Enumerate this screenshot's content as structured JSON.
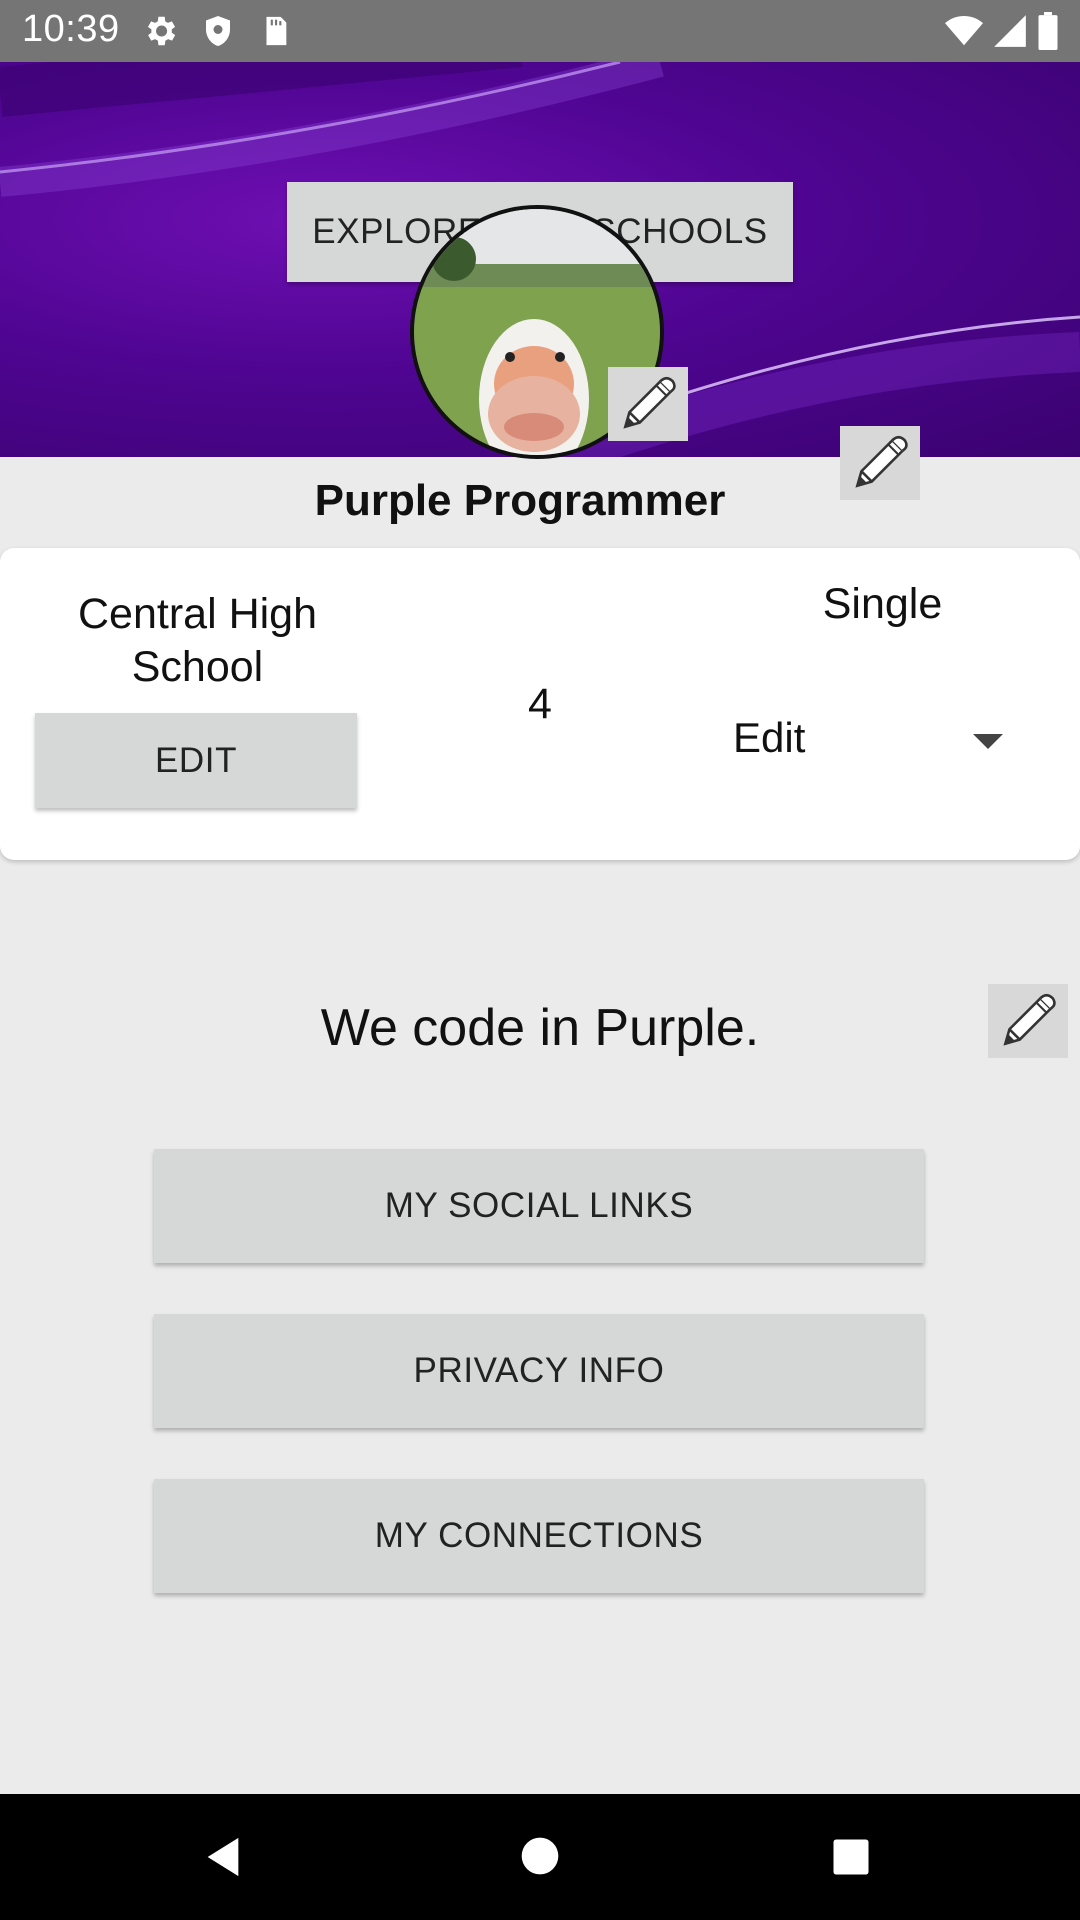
{
  "status_bar": {
    "time": "10:39",
    "icons": [
      "settings-icon",
      "shield-icon",
      "sd-card-icon",
      "wifi-icon",
      "signal-icon",
      "battery-icon"
    ]
  },
  "header": {
    "explore_button_label": "EXPLORE HIGH SCHOOLS",
    "avatar_icon": "avatar-photo-goose",
    "accent_color": "#4f0592"
  },
  "profile": {
    "name": "Purple Programmer"
  },
  "card": {
    "school_name": "Central High School",
    "edit_button_label": "EDIT",
    "grade": "4",
    "relationship_status": "Single",
    "status_dropdown_selected": "Edit"
  },
  "bio": {
    "text": "We code in Purple."
  },
  "actions": {
    "social_links_label": "MY SOCIAL LINKS",
    "privacy_info_label": "PRIVACY INFO",
    "connections_label": "MY CONNECTIONS"
  },
  "nav_bar": {
    "icons": [
      "back-icon",
      "home-icon",
      "recents-icon"
    ]
  }
}
